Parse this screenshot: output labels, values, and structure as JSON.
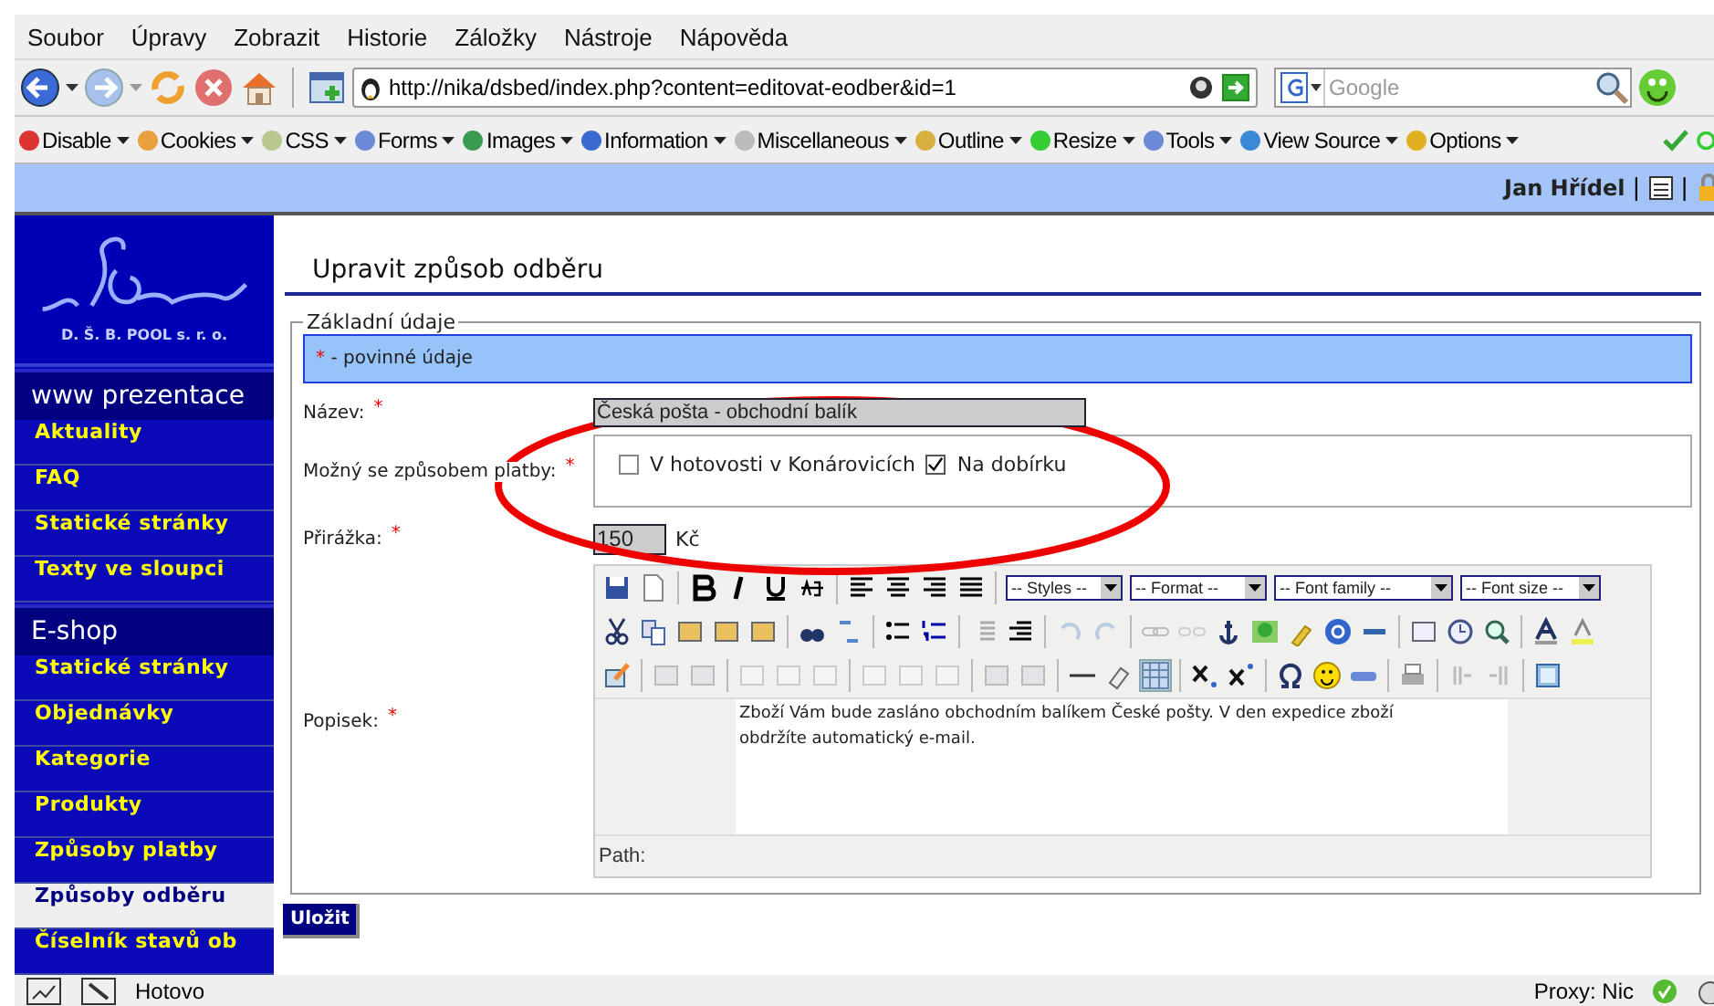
{
  "menubar": [
    {
      "label": "Soubor"
    },
    {
      "label": "Úpravy"
    },
    {
      "label": "Zobrazit"
    },
    {
      "label": "Historie"
    },
    {
      "label": "Záložky"
    },
    {
      "label": "Nástroje"
    },
    {
      "label": "Nápověda"
    }
  ],
  "address": {
    "value": "http://nika/dsbed/index.php?content=editovat-eodber&id=1"
  },
  "search": {
    "placeholder": "Google"
  },
  "dev_toolbar": [
    {
      "label": "Disable"
    },
    {
      "label": "Cookies"
    },
    {
      "label": "CSS"
    },
    {
      "label": "Forms"
    },
    {
      "label": "Images"
    },
    {
      "label": "Information"
    },
    {
      "label": "Miscellaneous"
    },
    {
      "label": "Outline"
    },
    {
      "label": "Resize"
    },
    {
      "label": "Tools"
    },
    {
      "label": "View Source"
    },
    {
      "label": "Options"
    }
  ],
  "user_bar": {
    "name": "Jan Hřídel",
    "separators": [
      "|",
      "|"
    ]
  },
  "logo": {
    "text": "D. Š. B. POOL s. r. o."
  },
  "sidebar": [
    {
      "heading": "www prezentace",
      "items": [
        {
          "label": "Aktuality",
          "selected": false
        },
        {
          "label": "FAQ",
          "selected": false
        },
        {
          "label": "Statické stránky",
          "selected": false
        },
        {
          "label": "Texty ve sloupci",
          "selected": false
        }
      ]
    },
    {
      "heading": "E-shop",
      "items": [
        {
          "label": "Statické stránky",
          "selected": false
        },
        {
          "label": "Objednávky",
          "selected": false
        },
        {
          "label": "Kategorie",
          "selected": false
        },
        {
          "label": "Produkty",
          "selected": false
        },
        {
          "label": "Způsoby platby",
          "selected": false
        },
        {
          "label": "Způsoby odběru",
          "selected": true
        },
        {
          "label": "Číselník stavů ob",
          "selected": false
        }
      ]
    }
  ],
  "page_title": "Upravit způsob odběru",
  "fieldset": {
    "legend": "Základní údaje",
    "note_mark": "*",
    "note": "- povinné údaje"
  },
  "fields": [
    {
      "kind": "text",
      "label": "Název:",
      "mark": "*",
      "value": "Česká pošta - obchodní balík"
    },
    {
      "kind": "checkboxes",
      "label": "Možný se způsobem platby:",
      "mark": "*",
      "options": [
        {
          "label": "V hotovosti v Konárovicích",
          "checked": false
        },
        {
          "label": "Na dobírku",
          "checked": true
        }
      ]
    },
    {
      "kind": "amount",
      "label": "Přirážka:",
      "mark": "*",
      "value": "150",
      "unit": "Kč"
    },
    {
      "kind": "editor",
      "label": "Popisek:",
      "mark": "*",
      "selects": [
        "-- Styles --",
        "-- Format --",
        "-- Font family --",
        "-- Font size --"
      ],
      "content": "Zboží Vám bude zasláno obchodním balíkem České pošty. V den expedice zboží obdržíte automatický e-mail.",
      "path_label": "Path:"
    }
  ],
  "save_button": "Uložit",
  "status_bar": {
    "text": "Hotovo",
    "proxy": "Proxy: Nic"
  },
  "annotation": {
    "kind": "ellipse"
  }
}
